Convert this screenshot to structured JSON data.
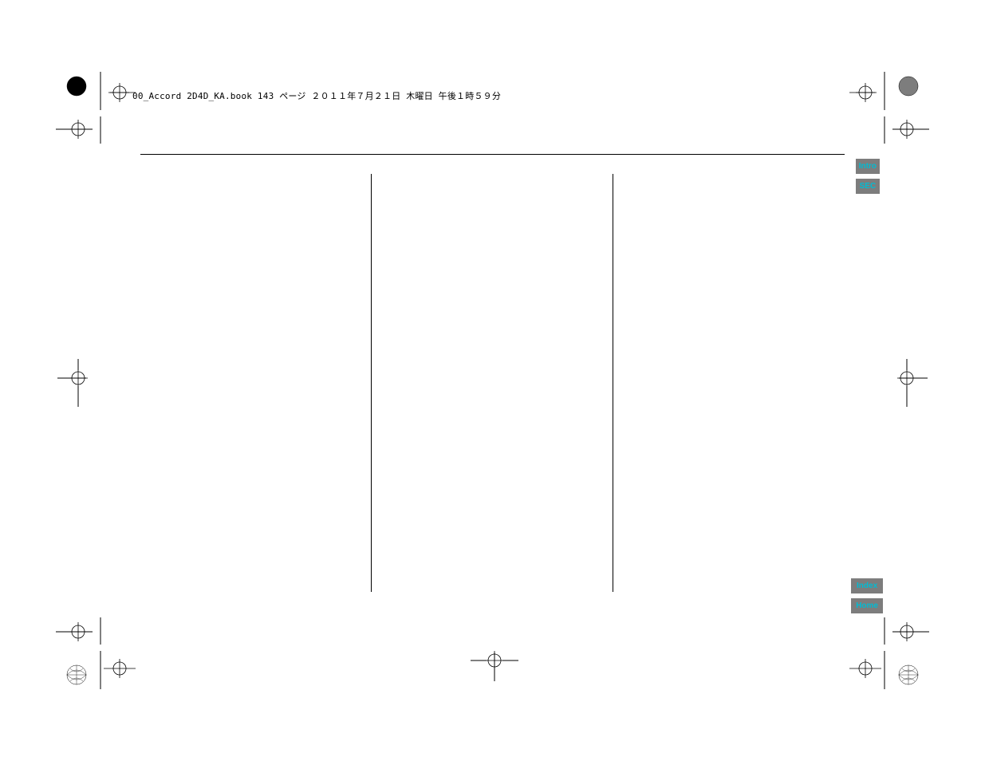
{
  "header_line": "00_Accord 2D4D_KA.book  143 ページ  ２０１１年７月２１日  木曜日  午後１時５９分",
  "nav": {
    "top": [
      "Intro",
      "SEC"
    ],
    "bottom": [
      "Index",
      "Home"
    ]
  }
}
